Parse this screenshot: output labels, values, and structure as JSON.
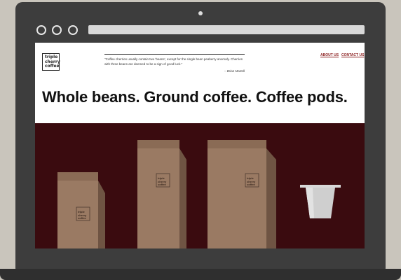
{
  "site": {
    "logo_lines": [
      "triple",
      "cherry",
      "coffee"
    ],
    "quote": "\"Coffee cherries usually contain two 'beans', except for the single bean peaberry anomaly. Cherries with three beans are deemed to be a sign of good luck.\"",
    "quote_author": "– Brian Martell",
    "nav": [
      "ABOUT US",
      "CONTACT US"
    ],
    "headline": "Whole beans. Ground coffee. Coffee pods.",
    "package_label": [
      "triple",
      "cherry",
      "coffee"
    ]
  },
  "colors": {
    "laptop_frame": "#3d3d3d",
    "band": "#3a0b0f",
    "bag": "#9a7a63",
    "nav_link": "#8b1e1e"
  }
}
